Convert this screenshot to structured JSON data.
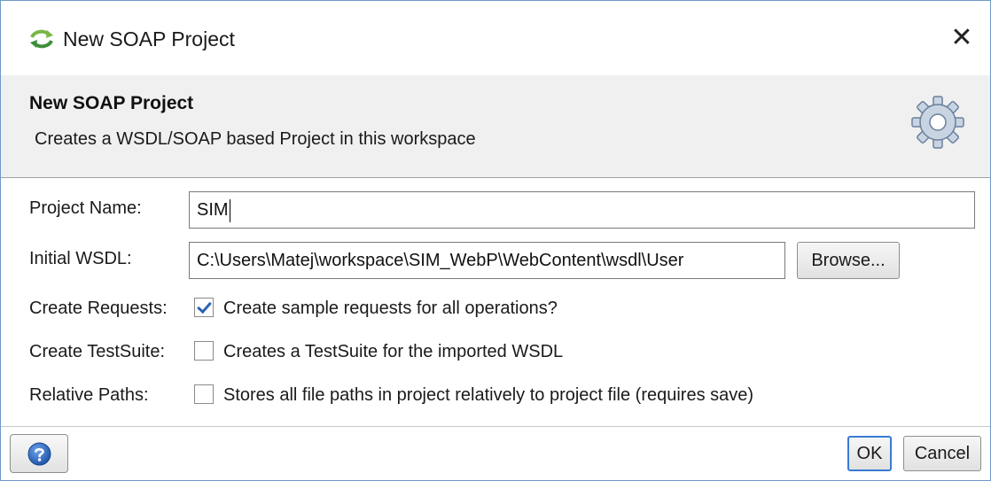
{
  "window": {
    "title": "New SOAP Project",
    "close_glyph": "✕",
    "app_icon": "soapui-arrows-icon"
  },
  "banner": {
    "title": "New SOAP Project",
    "description": "Creates a WSDL/SOAP based Project in this workspace",
    "icon": "gear-icon"
  },
  "form": {
    "project_name": {
      "label": "Project Name:",
      "value": "SIM"
    },
    "initial_wsdl": {
      "label": "Initial WSDL:",
      "value": "C:\\Users\\Matej\\workspace\\SIM_WebP\\WebContent\\wsdl\\User",
      "browse_label": "Browse..."
    },
    "create_requests": {
      "label": "Create Requests:",
      "checked": true,
      "text": "Create sample requests for all operations?"
    },
    "create_testsuite": {
      "label": "Create TestSuite:",
      "checked": false,
      "text": "Creates a TestSuite for the imported WSDL"
    },
    "relative_paths": {
      "label": "Relative Paths:",
      "checked": false,
      "text": "Stores all file paths in project relatively to project file (requires save)"
    }
  },
  "footer": {
    "help_icon": "help-icon",
    "ok_label": "OK",
    "cancel_label": "Cancel"
  },
  "colors": {
    "window_border": "#6d9bc7",
    "banner_bg": "#f0f0f0",
    "check_accent": "#2a62b8",
    "help_blue": "#2d6bc4"
  }
}
